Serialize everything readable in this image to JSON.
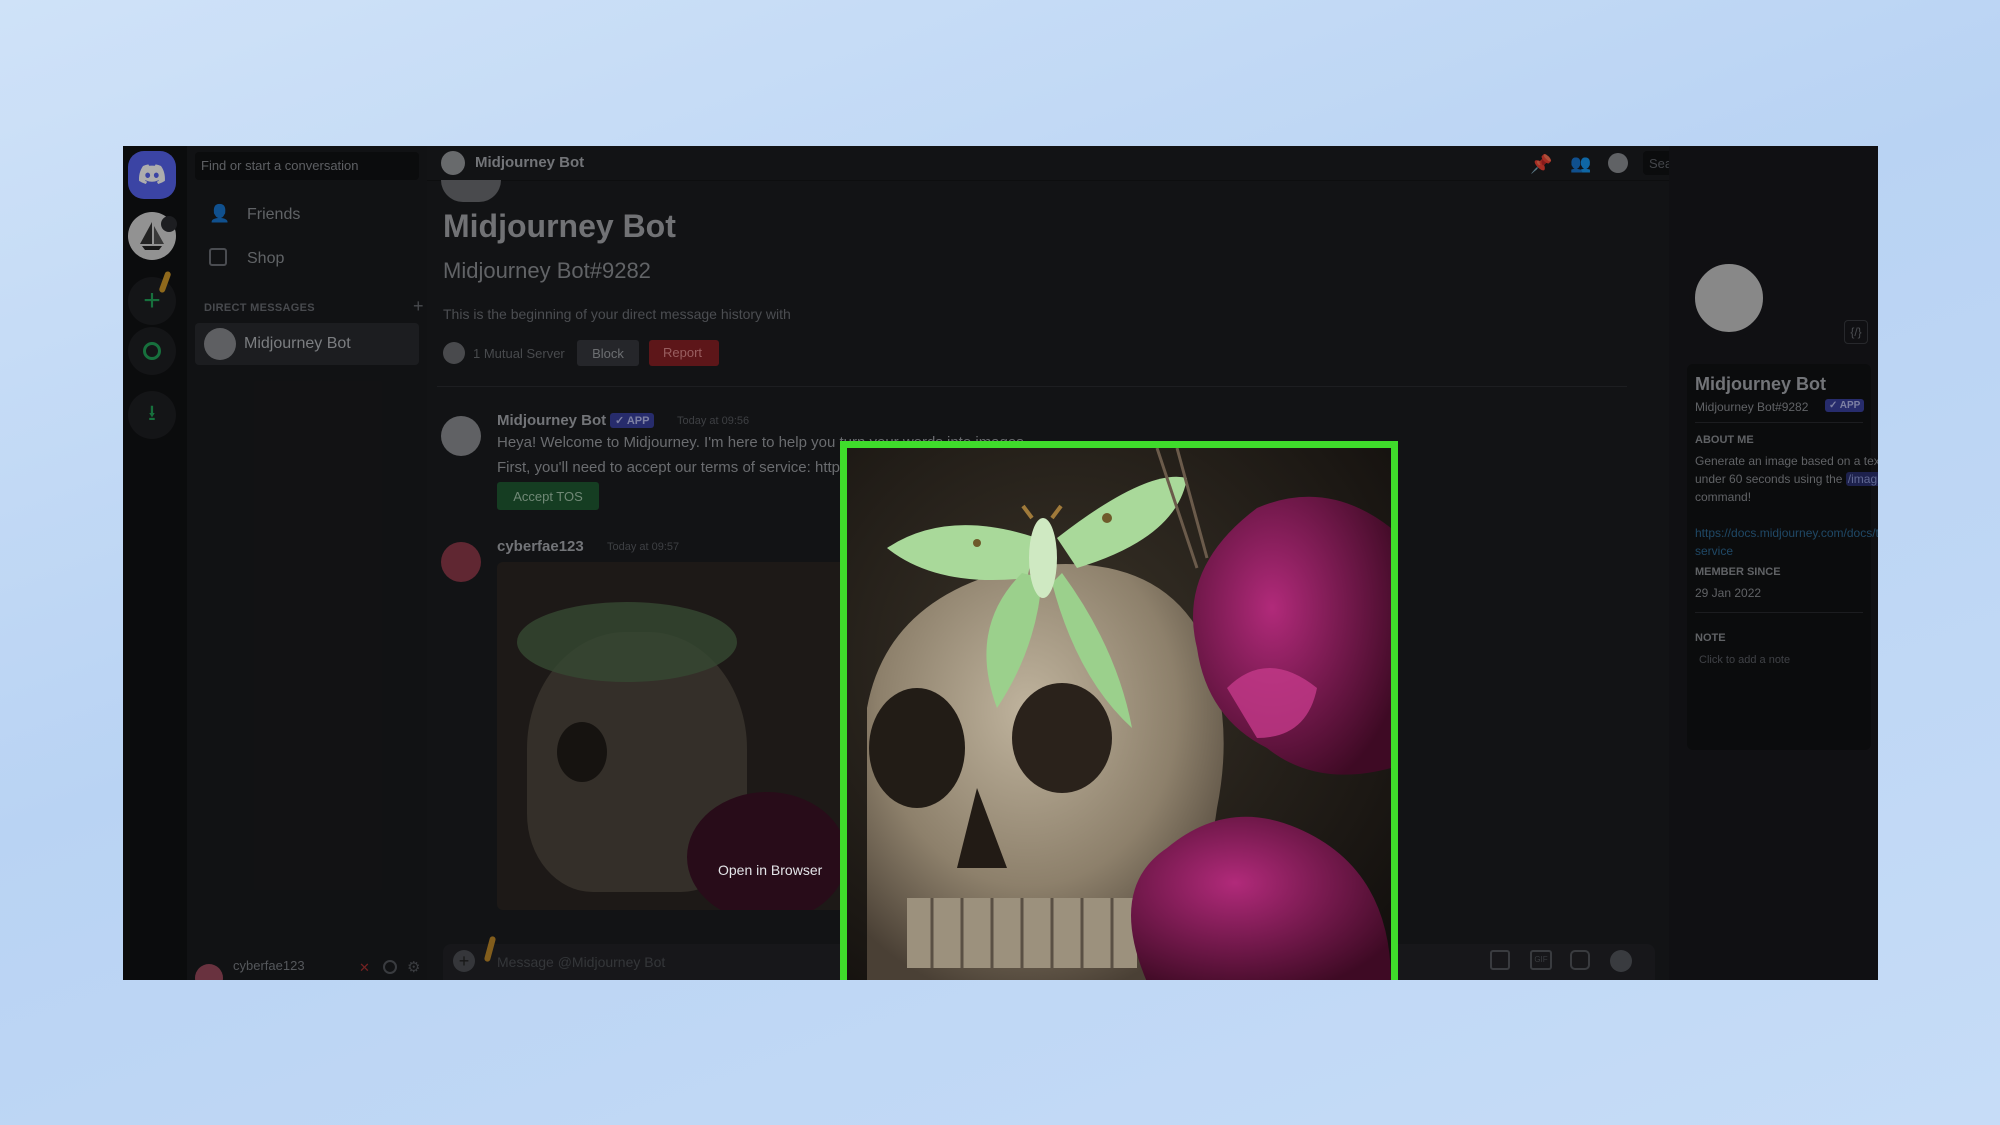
{
  "colors": {
    "accent": "#5865f2",
    "highlight_border": "#3fdc2b",
    "danger": "#da373c",
    "success": "#248046",
    "link": "#00a8fc"
  },
  "dm_sidebar": {
    "search_placeholder": "Find or start a conversation",
    "friends": "Friends",
    "shop": "Shop",
    "section_label": "DIRECT MESSAGES",
    "dm_name": "Midjourney Bot",
    "user_name": "cyberfae123"
  },
  "header": {
    "title": "Midjourney Bot",
    "search_placeholder": "Search"
  },
  "intro": {
    "name": "Midjourney Bot",
    "tag": "Midjourney Bot#9282",
    "desc": "This is the beginning of your direct message history with",
    "mutual": "1 Mutual Server",
    "block": "Block",
    "report": "Report"
  },
  "messages": [
    {
      "author": "Midjourney Bot",
      "badge": "✓ APP",
      "time": "Today at 09:56",
      "line1": "Heya! Welcome to Midjourney. I'm here to help you turn your words into images.",
      "line2": "First, you'll need to accept our terms of service: https://docs.midjourney.com/docs/terms-of-service",
      "button": "Accept TOS"
    },
    {
      "author": "cyberfae123",
      "time": "Today at 09:57"
    }
  ],
  "composer": {
    "placeholder": "Message @Midjourney Bot"
  },
  "lightbox": {
    "open_link": "Open in Browser"
  },
  "profile": {
    "name": "Midjourney Bot",
    "tag": "Midjourney Bot#9282",
    "badge": "✓ APP",
    "about_label": "ABOUT ME",
    "about_1": "Generate an image based on a text prompt in",
    "about_2a": "under 60 seconds using the ",
    "about_cmd": "/imagine",
    "about_3": "command!",
    "link_1": "https://docs.midjourney.com/docs/terms-of-",
    "link_2": "service",
    "member_label": "MEMBER SINCE",
    "member_date": "29 Jan 2022",
    "note_label": "NOTE",
    "note_placeholder": "Click to add a note"
  },
  "icons": [
    "discord-logo-icon",
    "speaker-icon",
    "add-server-icon",
    "explore-icon",
    "download-icon",
    "friends-icon",
    "shop-icon",
    "plus-icon",
    "pin-icon",
    "add-friend-icon",
    "profile-icon",
    "search-icon",
    "inbox-icon",
    "help-icon",
    "gift-icon",
    "gif-icon",
    "sticker-icon",
    "emoji-icon",
    "code-icon",
    "mic-icon",
    "headphones-icon",
    "settings-icon"
  ]
}
